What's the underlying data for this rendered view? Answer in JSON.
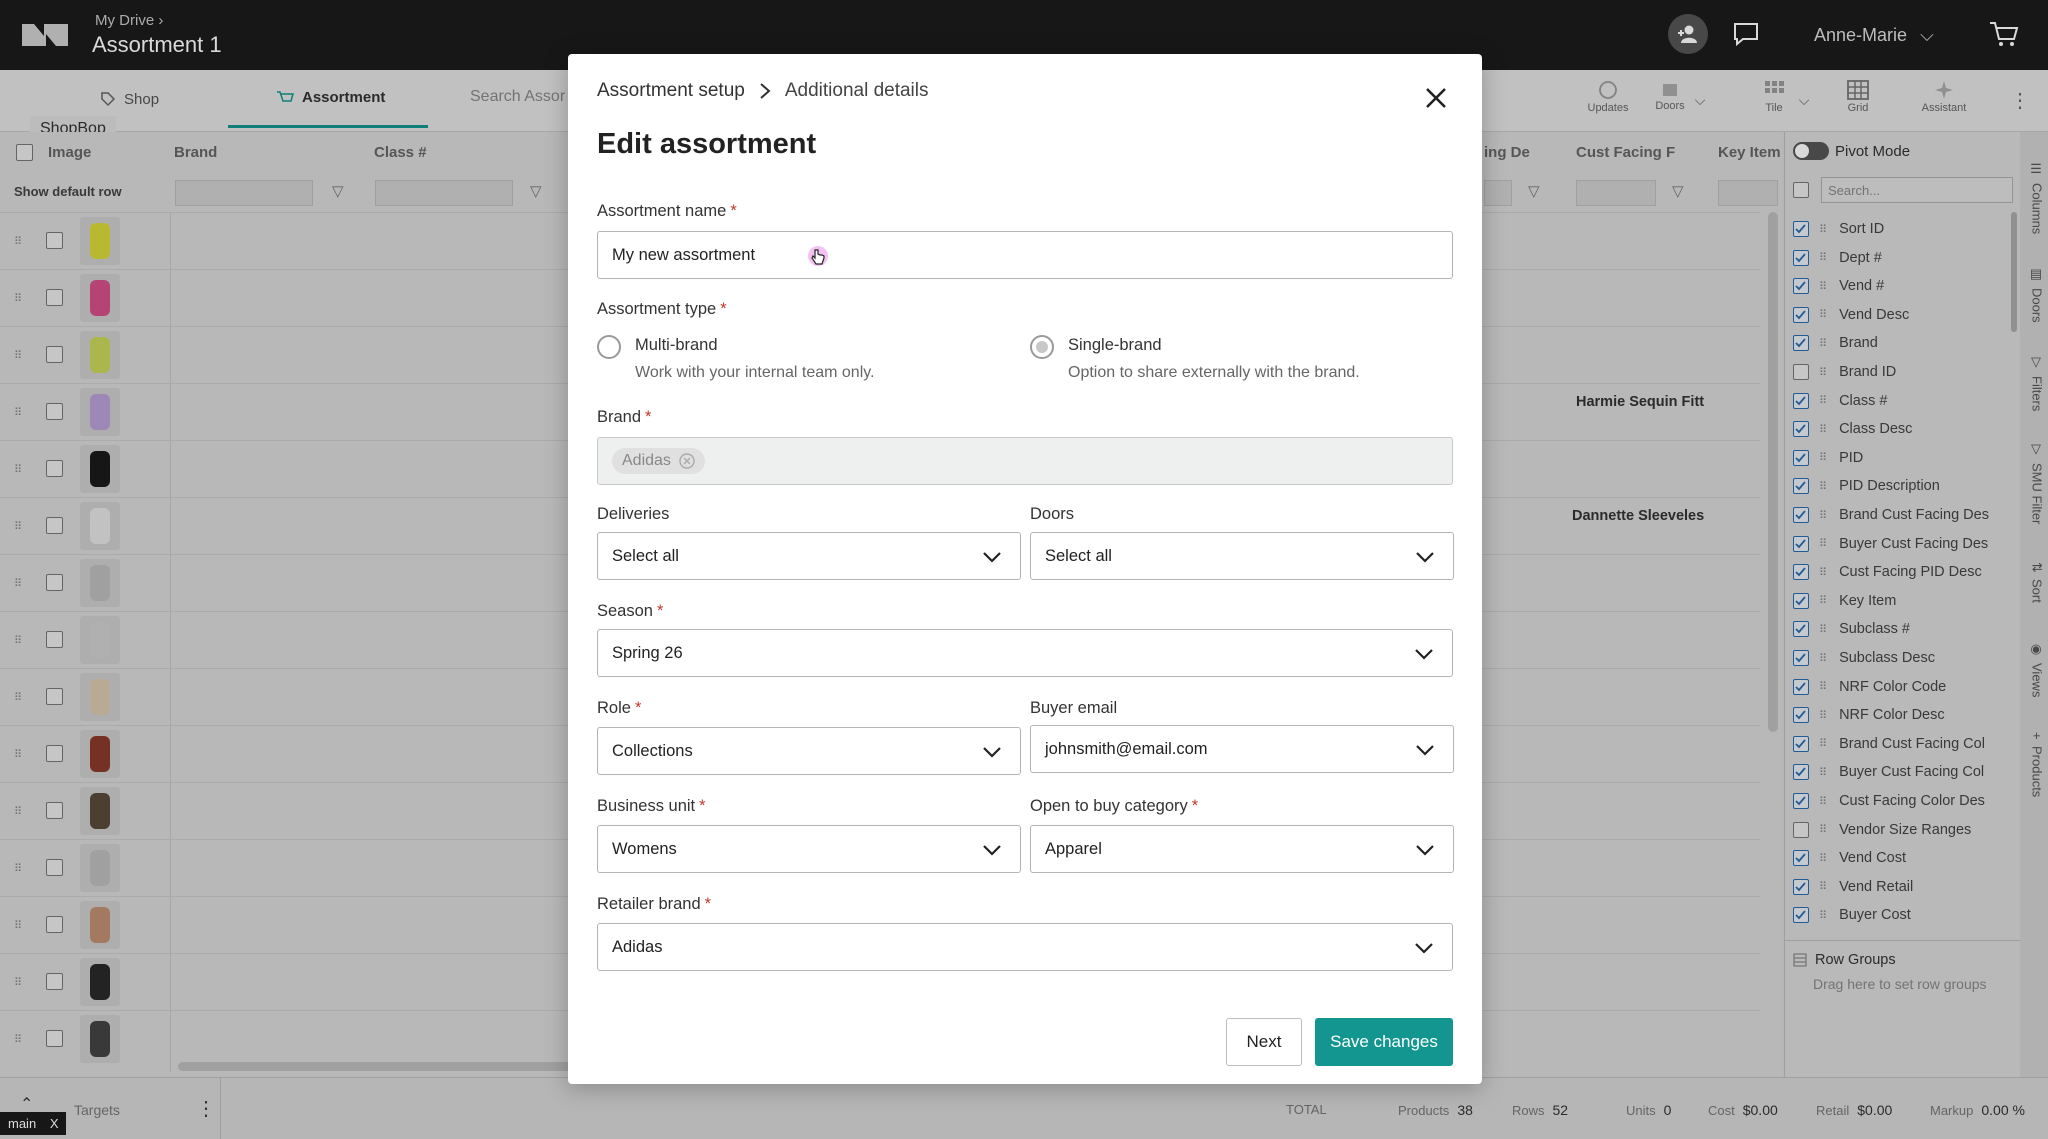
{
  "header": {
    "breadcrumb": "My Drive",
    "title": "Assortment 1",
    "user": "Anne-Marie"
  },
  "toolbar": {
    "tabs": [
      {
        "label": "Shop"
      },
      {
        "label": "Assortment"
      }
    ],
    "search_placeholder": "Search Assor",
    "store_label": "ShopBop",
    "buttons": [
      {
        "label": "Updates"
      },
      {
        "label": "Doors"
      },
      {
        "label": "Tile"
      },
      {
        "label": "Grid"
      },
      {
        "label": "Assistant"
      }
    ]
  },
  "grid": {
    "headers": {
      "image": "Image",
      "brand": "Brand",
      "class": "Class #",
      "ing_de": "ing De",
      "cust_facing": "Cust Facing F",
      "key_item": "Key Item"
    },
    "show_default_row": "Show default row",
    "row_texts": {
      "r4": "Harmie Sequin Fitt",
      "r6": "Dannette Sleeveles"
    },
    "thumb_colors": [
      "#d9d93a",
      "#d5508a",
      "#c9d85a",
      "#b9a0d8",
      "#1b1b1b",
      "#e4e4e4",
      "#bdbdbd",
      "#cfcfcf",
      "#d9c8b0",
      "#8a3a2a",
      "#5a4a3a",
      "#bdbdbd",
      "#c09070",
      "#2a2a2a",
      "#444444"
    ]
  },
  "sidepanel": {
    "pivot_mode": "Pivot Mode",
    "search_placeholder": "Search...",
    "columns": [
      {
        "label": "Sort ID",
        "checked": true
      },
      {
        "label": "Dept #",
        "checked": true
      },
      {
        "label": "Vend #",
        "checked": true
      },
      {
        "label": "Vend Desc",
        "checked": true
      },
      {
        "label": "Brand",
        "checked": true
      },
      {
        "label": "Brand ID",
        "checked": false
      },
      {
        "label": "Class #",
        "checked": true
      },
      {
        "label": "Class Desc",
        "checked": true
      },
      {
        "label": "PID",
        "checked": true
      },
      {
        "label": "PID Description",
        "checked": true
      },
      {
        "label": "Brand Cust Facing Des",
        "checked": true
      },
      {
        "label": "Buyer Cust Facing Des",
        "checked": true
      },
      {
        "label": "Cust Facing PID Desc",
        "checked": true
      },
      {
        "label": "Key Item",
        "checked": true
      },
      {
        "label": "Subclass #",
        "checked": true
      },
      {
        "label": "Subclass Desc",
        "checked": true
      },
      {
        "label": "NRF Color Code",
        "checked": true
      },
      {
        "label": "NRF Color Desc",
        "checked": true
      },
      {
        "label": "Brand Cust Facing Col",
        "checked": true
      },
      {
        "label": "Buyer Cust Facing Col",
        "checked": true
      },
      {
        "label": "Cust Facing Color Des",
        "checked": true
      },
      {
        "label": "Vendor Size Ranges",
        "checked": false
      },
      {
        "label": "Vend Cost",
        "checked": true
      },
      {
        "label": "Vend Retail",
        "checked": true
      },
      {
        "label": "Buyer Cost",
        "checked": true
      }
    ],
    "row_groups": "Row Groups",
    "row_groups_hint": "Drag here to set row groups",
    "vtabs": [
      "Columns",
      "Doors",
      "Filters",
      "SMU Filter",
      "Sort",
      "Views",
      "Products"
    ]
  },
  "footer": {
    "targets": "Targets",
    "total": "TOTAL",
    "stats": [
      {
        "label": "Products",
        "value": "38"
      },
      {
        "label": "Rows",
        "value": "52"
      },
      {
        "label": "Units",
        "value": "0"
      },
      {
        "label": "Cost",
        "value": "$0.00"
      },
      {
        "label": "Retail",
        "value": "$0.00"
      },
      {
        "label": "Markup",
        "value": "0.00 %"
      }
    ],
    "branch": "main",
    "branch_close": "X"
  },
  "modal": {
    "crumb_parent": "Assortment setup",
    "crumb_current": "Additional details",
    "title": "Edit assortment",
    "name_label": "Assortment name",
    "name_value": "My new assortment",
    "type_label": "Assortment type",
    "multi_label": "Multi-brand",
    "multi_desc": "Work with your internal team only.",
    "single_label": "Single-brand",
    "single_desc": "Option to share externally with the brand.",
    "brand_label": "Brand",
    "brand_chip": "Adidas",
    "deliveries_label": "Deliveries",
    "deliveries_value": "Select all",
    "doors_label": "Doors",
    "doors_value": "Select all",
    "season_label": "Season",
    "season_value": "Spring 26",
    "role_label": "Role",
    "role_value": "Collections",
    "buyer_email_label": "Buyer email",
    "buyer_email_value": "johnsmith@email.com",
    "business_unit_label": "Business unit",
    "business_unit_value": "Womens",
    "otb_label": "Open to buy category",
    "otb_value": "Apparel",
    "retailer_brand_label": "Retailer brand",
    "retailer_brand_value": "Adidas",
    "next_label": "Next",
    "save_label": "Save changes",
    "accent": "#13968f",
    "required_mark": "*"
  }
}
